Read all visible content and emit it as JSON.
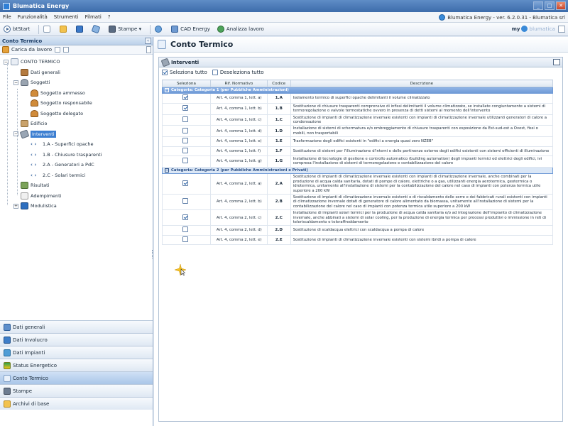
{
  "window": {
    "title": "Blumatica Energy",
    "buttons": [
      "_",
      "□",
      "✕"
    ]
  },
  "menu": {
    "items": [
      "File",
      "Funzionalità",
      "Strumenti",
      "Filmati",
      "?"
    ],
    "version": "Blumatica Energy - ver. 6.2.0.31 - Blumatica srl"
  },
  "toolbar": {
    "start": "btStart",
    "print": "Stampe",
    "cad": "CAD Energy",
    "analyze": "Analizza lavoro",
    "brand_my": "my",
    "brand_name": "blumatica"
  },
  "left_panel": {
    "header": "Conto Termico",
    "workload": "Carica da lavoro",
    "tree": [
      {
        "label": "CONTO TERMICO",
        "icon": "doc-icon",
        "level": 0,
        "expander": "−"
      },
      {
        "label": "Dati generali",
        "icon": "book-icon",
        "level": 1
      },
      {
        "label": "Soggetti",
        "icon": "people-icon",
        "level": 1,
        "expander": "−"
      },
      {
        "label": "Soggetto ammesso",
        "icon": "person-icon",
        "level": 2
      },
      {
        "label": "Soggetto responsabile",
        "icon": "person-icon",
        "level": 2
      },
      {
        "label": "Soggetto delegato",
        "icon": "person-icon",
        "level": 2
      },
      {
        "label": "Edificio",
        "icon": "building-icon",
        "level": 1
      },
      {
        "label": "Interventi",
        "icon": "tools-icon",
        "level": 1,
        "expander": "−",
        "selected": true
      },
      {
        "label": "1.A - Superfici opache",
        "icon": "code-icon",
        "level": 2
      },
      {
        "label": "1.B - Chiusure trasparenti",
        "icon": "code-icon",
        "level": 2
      },
      {
        "label": "2.A - Generatori a PdC",
        "icon": "code-icon",
        "level": 2
      },
      {
        "label": "2.C - Solari termici",
        "icon": "code-icon",
        "level": 2
      },
      {
        "label": "Risultati",
        "icon": "results-icon",
        "level": 1
      },
      {
        "label": "Adempimenti",
        "icon": "obligations-icon",
        "level": 1
      },
      {
        "label": "Modulistica",
        "icon": "modules-icon",
        "level": 1,
        "expander": "+"
      }
    ],
    "nav": [
      {
        "label": "Dati generali",
        "icon": "dg"
      },
      {
        "label": "Dati Involucro",
        "icon": "dinv"
      },
      {
        "label": "Dati Impianti",
        "icon": "dimp"
      },
      {
        "label": "Status Energetico",
        "icon": "status"
      },
      {
        "label": "Conto Termico",
        "icon": "ct",
        "active": true
      },
      {
        "label": "Stampe",
        "icon": "print"
      },
      {
        "label": "Archivi di base",
        "icon": "archive"
      }
    ]
  },
  "main": {
    "title": "Conto Termico",
    "section_title": "Interventi",
    "select_all": "Seleziona tutto",
    "deselect_all": "Deseleziona tutto",
    "columns": [
      "Seleziona",
      "Rif. Normativo",
      "Codice",
      "Descrizione"
    ],
    "categories": [
      {
        "label": "Categoria: Categoria 1 (per Pubbliche Amministrazioni)",
        "rows": [
          {
            "checked": true,
            "ref": "Art. 4, comma 1, lett. a)",
            "code": "1.A",
            "desc": "Isolamento termico di superfici opache delimitanti il volume climatizzato"
          },
          {
            "checked": true,
            "ref": "Art. 4, comma 1, lett. b)",
            "code": "1.B",
            "desc": "Sostituzione di chiusure trasparenti comprensive di infissi delimitanti il volume climatizzato, se installate congiuntamente a sistemi di termoregolazione o valvole termostatiche ovvero in presenza di detti sistemi al momento dell'intervento"
          },
          {
            "checked": false,
            "ref": "Art. 4, comma 1, lett. c)",
            "code": "1.C",
            "desc": "Sostituzione di impianti di climatizzazione invernale esistenti con impianti di climatizzazione invernale utilizzanti generatori di calore a condensazione"
          },
          {
            "checked": false,
            "ref": "Art. 4, comma 1, lett. d)",
            "code": "1.D",
            "desc": "Installazione di sistemi di schermatura e/o ombreggiamento di chiusure trasparenti con esposizione da Est-sud-est a Ovest, fissi o mobili, non trasportabili"
          },
          {
            "checked": false,
            "ref": "Art. 4, comma 1, lett. e)",
            "code": "1.E",
            "desc": "Trasformazione degli edifici esistenti in \"edifici a energia quasi zero NZEB\""
          },
          {
            "checked": false,
            "ref": "Art. 4, comma 1, lett. f)",
            "code": "1.F",
            "desc": "Sostituzione di sistemi per l'illuminazione d'interni e delle pertinenze esterne degli edifici esistenti con sistemi efficienti di illuminazione"
          },
          {
            "checked": false,
            "ref": "Art. 4, comma 1, lett. g)",
            "code": "1.G",
            "desc": "Installazione di tecnologie di gestione e controllo automatico (building automation) degli impianti termici ed elettrici degli edifici, ivi compresa l'installazione di sistemi di termoregolazione e contabilizzazione del calore"
          }
        ]
      },
      {
        "label": "Categoria: Categoria 2 (per Pubbliche Amministrazioni e Privati)",
        "rows": [
          {
            "checked": true,
            "ref": "Art. 4, comma 2, lett. a)",
            "code": "2.A",
            "desc": "Sostituzione di impianti di climatizzazione invernale esistenti con impianti di climatizzazione invernale, anche combinati per la produzione di acqua calda sanitaria, dotati di pompe di calore, elettriche o a gas, utilizzanti energia aerotermica, geotermica o idrotermica, unitamente all'installazione di sistemi per la contabilizzazione del calore nel caso di impianti con potenza termica utile superiore a 200 kW"
          },
          {
            "checked": false,
            "ref": "Art. 4, comma 2, lett. b)",
            "code": "2.B",
            "desc": "Sostituzione di impianti di climatizzazione invernale esistenti o di riscaldamento delle serre e dei fabbricati rurali esistenti con impianti di climatizzazione invernale dotati di generatore di calore alimentato da biomassa, unitamente all'installazione di sistemi per la contabilizzazione del calore nel caso di impianti con potenza termica utile superiore a 200 kW"
          },
          {
            "checked": true,
            "ref": "Art. 4, comma 2, lett. c)",
            "code": "2.C",
            "desc": "Installazione di impianti solari termici per la produzione di acqua calda sanitaria e/o ad integrazione dell'impianto di climatizzazione invernale, anche abbinati a sistemi di solar cooling, per la produzione di energia termica per processi produttivi o immissione in reti di teleriscaldamento e teleraffreddamento"
          },
          {
            "checked": false,
            "ref": "Art. 4, comma 2, lett. d)",
            "code": "2.D",
            "desc": "Sostituzione di scaldacqua elettrici con scaldacqua a pompa di calore"
          },
          {
            "checked": false,
            "ref": "Art. 4, comma 2, lett. e)",
            "code": "2.E",
            "desc": "Sostituzione di impianti di climatizzazione invernale esistenti con sistemi ibridi a pompa di calore"
          }
        ]
      }
    ]
  }
}
